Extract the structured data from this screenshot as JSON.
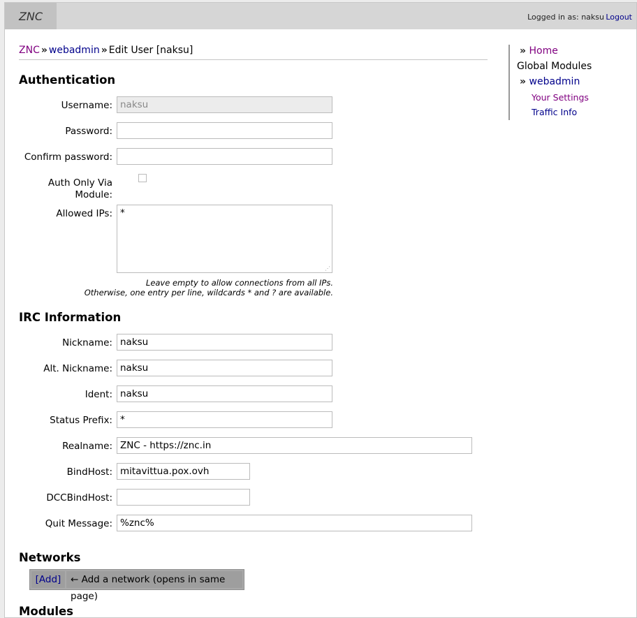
{
  "header": {
    "brand": "ZNC",
    "logged_in": "Logged in as: naksu",
    "logout": "Logout"
  },
  "breadcrumb": {
    "znc": "ZNC",
    "sep1": "»",
    "webadmin": "webadmin",
    "sep2": "»",
    "current": "Edit User [naksu]"
  },
  "auth": {
    "title": "Authentication",
    "username_label": "Username:",
    "username_value": "naksu",
    "password_label": "Password:",
    "password_value": "",
    "confirm_label": "Confirm password:",
    "confirm_value": "",
    "authonly_label_1": "Auth Only Via",
    "authonly_label_2": "Module:",
    "allowed_label": "Allowed IPs:",
    "allowed_value": "*",
    "hint_1": "Leave empty to allow connections from all IPs.",
    "hint_2": "Otherwise, one entry per line, wildcards * and ? are available."
  },
  "irc": {
    "title": "IRC Information",
    "nick_label": "Nickname:",
    "nick_value": "naksu",
    "altnick_label": "Alt. Nickname:",
    "altnick_value": "naksu",
    "ident_label": "Ident:",
    "ident_value": "naksu",
    "prefix_label": "Status Prefix:",
    "prefix_value": "*",
    "realname_label": "Realname:",
    "realname_value": "ZNC - https://znc.in",
    "bindhost_label": "BindHost:",
    "bindhost_value": "mitavittua.pox.ovh",
    "dccbind_label": "DCCBindHost:",
    "dccbind_value": "",
    "quit_label": "Quit Message:",
    "quit_value": "%znc%"
  },
  "networks": {
    "title": "Networks",
    "add": "[Add]",
    "desc": "← Add a network (opens in same page)"
  },
  "modules": {
    "title": "Modules"
  },
  "sidebar": {
    "arrow": "»",
    "home": "Home",
    "global_modules": "Global Modules",
    "webadmin": "webadmin",
    "your_settings": "Your Settings",
    "traffic_info": "Traffic Info"
  }
}
